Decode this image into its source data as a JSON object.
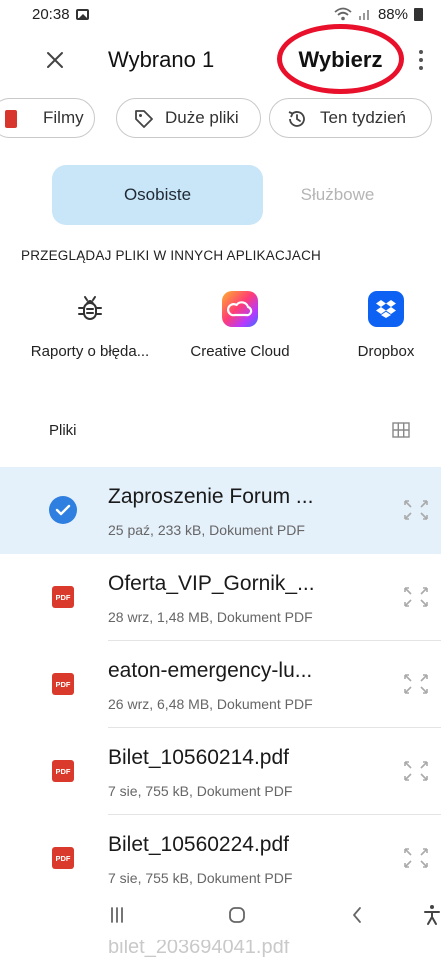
{
  "status_bar": {
    "time": "20:38",
    "battery": "88%",
    "icons": [
      "gallery-icon",
      "wifi-icon",
      "signal-icon",
      "battery-icon"
    ]
  },
  "toolbar": {
    "title": "Wybrano 1",
    "select_label": "Wybierz",
    "icons": [
      "close-icon",
      "more-vert-icon"
    ],
    "highlight_color": "#e8102a"
  },
  "chips": [
    {
      "label": "Filmy",
      "icon": "film-icon"
    },
    {
      "label": "Duże pliki",
      "icon": "tag-icon"
    },
    {
      "label": "Ten tydzień",
      "icon": "history-icon"
    }
  ],
  "tabs": {
    "personal": "Osobiste",
    "work": "Służbowe",
    "active": "personal",
    "active_color": "#c9e5f8"
  },
  "apps_section": {
    "title": "PRZEGLĄDAJ PLIKI W INNYCH APLIKACJACH",
    "apps": [
      {
        "label": "Raporty o błęda...",
        "icon": "bug-icon"
      },
      {
        "label": "Creative Cloud",
        "icon": "creative-cloud-icon"
      },
      {
        "label": "Dropbox",
        "icon": "dropbox-icon"
      }
    ]
  },
  "files": {
    "header": "Pliki",
    "view_toggle_icon": "grid-view-icon",
    "items": [
      {
        "name": "Zaproszenie Forum ...",
        "meta": "25 paź, 233 kB, Dokument PDF",
        "selected": true,
        "icon": "check-circle-icon"
      },
      {
        "name": "Oferta_VIP_Gornik_...",
        "meta": "28 wrz, 1,48 MB, Dokument PDF",
        "selected": false,
        "icon": "pdf-icon"
      },
      {
        "name": "eaton-emergency-lu...",
        "meta": "26 wrz, 6,48 MB, Dokument PDF",
        "selected": false,
        "icon": "pdf-icon"
      },
      {
        "name": "Bilet_10560214.pdf",
        "meta": "7 sie, 755 kB, Dokument PDF",
        "selected": false,
        "icon": "pdf-icon"
      },
      {
        "name": "Bilet_10560224.pdf",
        "meta": "7 sie, 755 kB, Dokument PDF",
        "selected": false,
        "icon": "pdf-icon"
      }
    ],
    "peek_name": "bilet_203694041.pdf",
    "pdf_badge": "PDF",
    "selected_color": "#e4f0fa",
    "pdf_color": "#d93a2b"
  },
  "nav_bar": {
    "icons": [
      "recent-apps-icon",
      "home-icon",
      "back-icon",
      "accessibility-icon"
    ]
  }
}
